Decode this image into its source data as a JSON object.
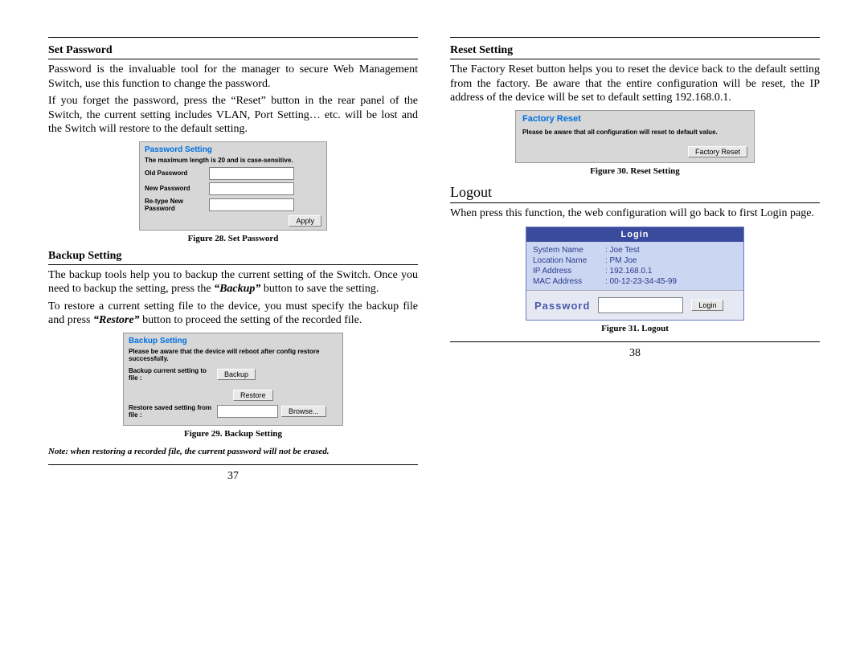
{
  "left": {
    "set_password_heading": "Set Password",
    "set_password_p1": "Password is the invaluable tool for the manager to secure Web Management Switch, use this function to change the password.",
    "set_password_p2": "If you forget the password, press the “Reset” button in the rear panel of the Switch, the current setting includes VLAN, Port Setting… etc. will be lost and the Switch will restore to the default setting.",
    "fig28": {
      "title": "Password Setting",
      "sub": "The maximum length is 20 and is case-sensitive.",
      "old_label": "Old Password",
      "new_label": "New Password",
      "retype_label": "Re-type New Password",
      "apply_btn": "Apply",
      "caption": "Figure 28. Set Password"
    },
    "backup_heading": "Backup Setting",
    "backup_p1_a": "The backup tools help you to backup the current setting of the Switch. Once you need to backup the setting, press the ",
    "backup_p1_b": "“Backup”",
    "backup_p1_c": " button to save the setting.",
    "backup_p2_a": "To restore a current setting file to the device, you must specify the backup file and press ",
    "backup_p2_b": "“Restore”",
    "backup_p2_c": " button to proceed the setting of the recorded file.",
    "fig29": {
      "title": "Backup Setting",
      "sub": "Please be aware that the device will reboot after config restore successfully.",
      "row1_label": "Backup current setting to file :",
      "backup_btn": "Backup",
      "row2_label": "Restore saved setting from file :",
      "restore_btn": "Restore",
      "browse_btn": "Browse...",
      "caption": "Figure 29. Backup Setting"
    },
    "note": "Note: when restoring a recorded file, the current password will not be erased.",
    "page_number": "37"
  },
  "right": {
    "reset_heading": "Reset Setting",
    "reset_p1": "The Factory Reset button helps you to reset the device back to the default setting from the factory. Be aware that the entire configuration will be reset, the IP address of the device will be set to default setting 192.168.0.1.",
    "fig30": {
      "title": "Factory Reset",
      "msg": "Please be aware that all configuration will reset to default value.",
      "btn": "Factory Reset",
      "caption": "Figure 30. Reset Setting"
    },
    "logout_heading": "Logout",
    "logout_p1": "When press this function, the web configuration will go back to first Login page.",
    "fig31": {
      "header": "Login",
      "system_name_k": "System Name",
      "system_name_v": ": Joe Test",
      "location_k": "Location Name",
      "location_v": ": PM Joe",
      "ip_k": "IP Address",
      "ip_v": ": 192.168.0.1",
      "mac_k": "MAC Address",
      "mac_v": ": 00-12-23-34-45-99",
      "pw_label": "Password",
      "login_btn": "Login",
      "caption": "Figure 31. Logout"
    },
    "page_number": "38"
  }
}
